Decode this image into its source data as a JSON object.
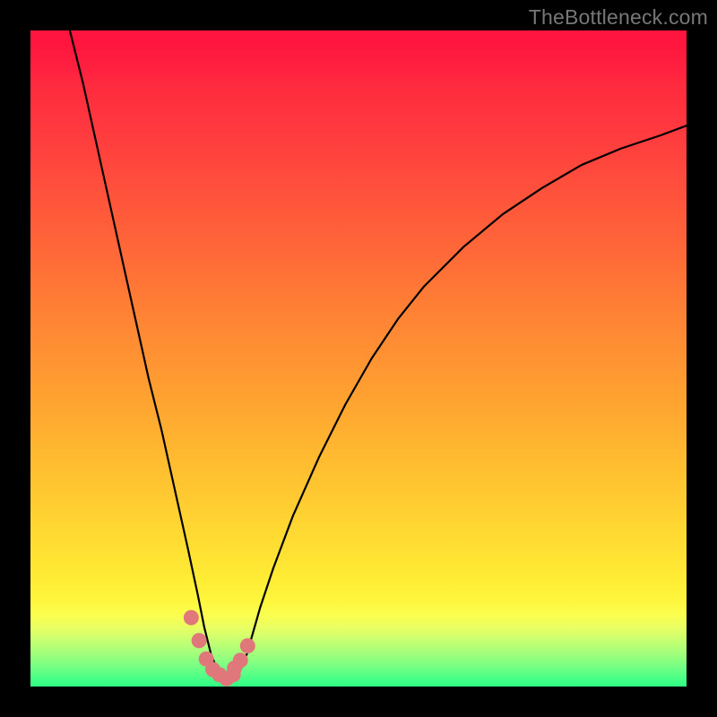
{
  "watermark": "TheBottleneck.com",
  "chart_data": {
    "type": "line",
    "title": "",
    "xlabel": "",
    "ylabel": "",
    "xlim": [
      0,
      100
    ],
    "ylim": [
      0,
      100
    ],
    "grid": false,
    "legend": false,
    "series": [
      {
        "name": "bottleneck-curve",
        "color": "#000000",
        "x": [
          6,
          8,
          10,
          12,
          14,
          16,
          18,
          20,
          22,
          24,
          25.5,
          26.5,
          27.5,
          28.5,
          30,
          31,
          32,
          33,
          34,
          35,
          37,
          40,
          44,
          48,
          52,
          56,
          60,
          66,
          72,
          78,
          84,
          90,
          96,
          100
        ],
        "y": [
          100,
          92,
          83,
          74,
          65,
          56,
          47,
          39,
          30,
          21,
          14,
          9,
          5,
          2.5,
          1,
          1.2,
          2.5,
          5,
          8.5,
          12,
          18,
          26,
          35,
          43,
          50,
          56,
          61,
          67,
          72,
          76,
          79.5,
          82,
          84,
          85.5
        ]
      },
      {
        "name": "highlight-dots",
        "color": "#e0777a",
        "type": "scatter",
        "x": [
          24.5,
          25.7,
          26.8,
          27.8,
          28.8,
          29.9,
          30.9,
          31.1,
          32.0,
          33.1
        ],
        "y": [
          10.5,
          7.0,
          4.2,
          2.6,
          1.8,
          1.2,
          1.8,
          2.8,
          4.0,
          6.2
        ]
      }
    ],
    "background_gradient": {
      "stops": [
        {
          "pos": 0.0,
          "color": "#ff153e"
        },
        {
          "pos": 0.25,
          "color": "#ff553b"
        },
        {
          "pos": 0.5,
          "color": "#ff9332"
        },
        {
          "pos": 0.75,
          "color": "#ffd231"
        },
        {
          "pos": 0.9,
          "color": "#e9ff62"
        },
        {
          "pos": 1.0,
          "color": "#2fff84"
        }
      ]
    }
  }
}
